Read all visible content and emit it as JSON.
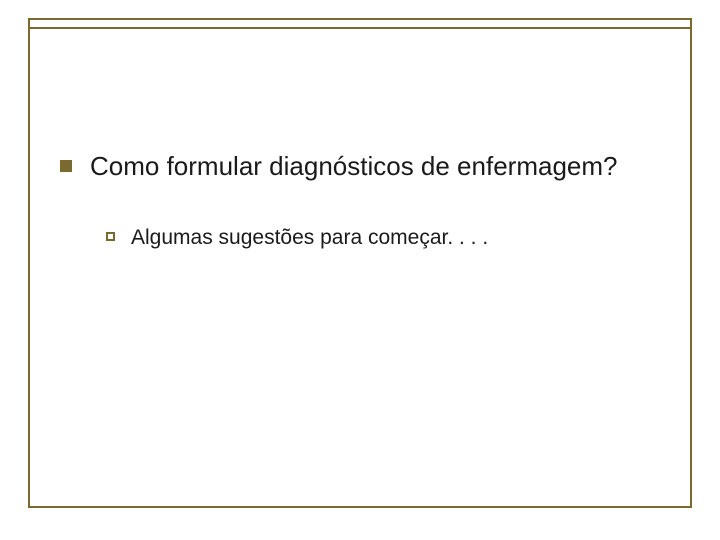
{
  "slide": {
    "main": {
      "text": "Como formular diagnósticos de enfermagem?"
    },
    "sub": {
      "text": "Algumas sugestões para começar. . . ."
    }
  }
}
